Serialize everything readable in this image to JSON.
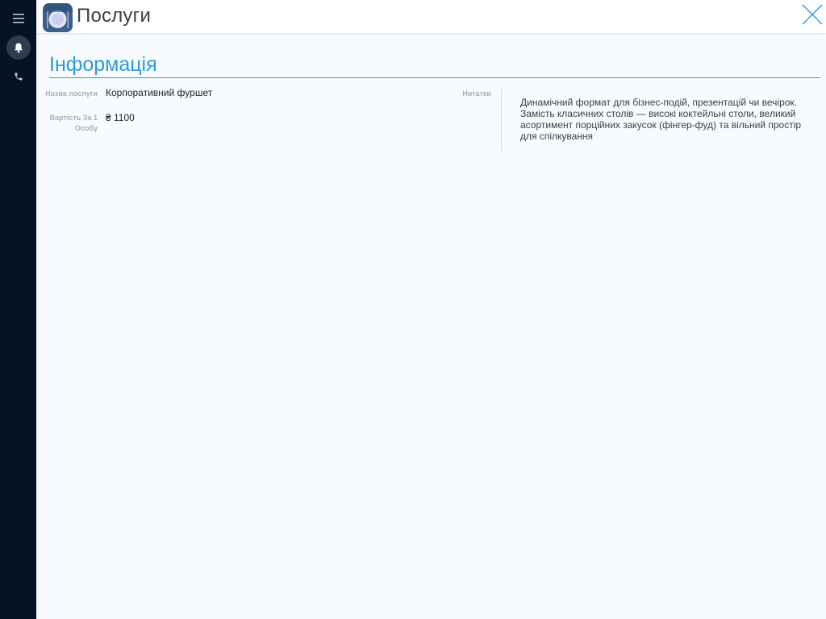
{
  "header": {
    "title": "Послуги",
    "app_icon": "plate-cutlery-icon",
    "close_icon": "close-icon"
  },
  "sidebar": {
    "items": [
      {
        "icon": "menu-icon"
      },
      {
        "icon": "bell-icon"
      },
      {
        "icon": "phone-icon"
      }
    ]
  },
  "section": {
    "title": "Інформація"
  },
  "fields": {
    "name_label": "Назва послуги",
    "name_value": "Корпоративний фуршет",
    "price_label": "Вартість За 1 Особу",
    "price_value": "₴ 1100",
    "notes_label": "Нотатки",
    "notes_value": "Динамічний формат для бізнес-подій, презентацій чи вечірок. Замість класичних столів — високі коктейльні столи, великий асортимент порційних закусок (фінгер-фуд) та вільний простір для спілкування"
  },
  "colors": {
    "accent": "#2b9bd8",
    "rail": "#061325",
    "background": "#f7fbfd"
  }
}
